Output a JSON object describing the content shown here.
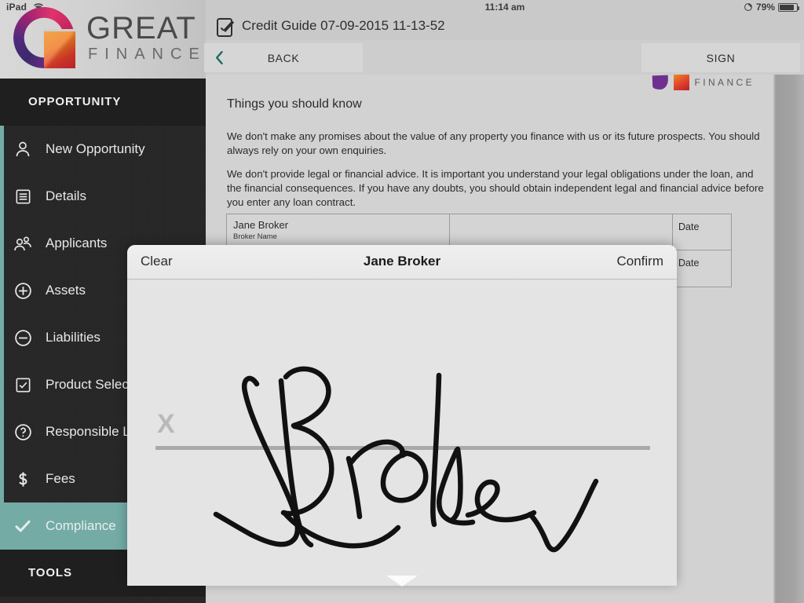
{
  "status_bar": {
    "device_label": "iPad",
    "wifi_icon": "wifi-icon",
    "clock": "11:14 am",
    "rotation_lock_icon": "rotation-lock-icon",
    "battery_percent": "79%",
    "battery_level": 79
  },
  "brand": {
    "name_primary": "GREAT",
    "name_secondary": "FINANCE",
    "logo_icon": "great-finance-logo",
    "colors": {
      "magenta": "#e0336e",
      "purple": "#512a7d",
      "orange": "#f0911f",
      "red": "#c9272c"
    }
  },
  "sidebar": {
    "sections": [
      {
        "header": "OPPORTUNITY",
        "items": [
          {
            "label": "New Opportunity",
            "icon": "person-icon",
            "active": false
          },
          {
            "label": "Details",
            "icon": "document-lines-icon",
            "active": false
          },
          {
            "label": "Applicants",
            "icon": "people-group-icon",
            "active": false
          },
          {
            "label": "Assets",
            "icon": "plus-circle-icon",
            "active": false
          },
          {
            "label": "Liabilities",
            "icon": "minus-circle-icon",
            "active": false
          },
          {
            "label": "Product Selection",
            "icon": "checkbox-icon",
            "active": false
          },
          {
            "label": "Responsible Lending",
            "icon": "question-circle-icon",
            "active": false
          },
          {
            "label": "Fees",
            "icon": "dollar-icon",
            "active": false
          },
          {
            "label": "Compliance",
            "icon": "checkmark-icon",
            "active": true
          }
        ]
      },
      {
        "header": "TOOLS",
        "items": []
      }
    ],
    "accent_color": "#74aba5",
    "background_color": "#262626"
  },
  "titlebar": {
    "icon": "signed-document-icon",
    "title": "Credit Guide 07-09-2015 11-13-52"
  },
  "toolbar": {
    "back_label": "BACK",
    "back_icon": "chevron-left-icon",
    "sign_label": "SIGN"
  },
  "document": {
    "logo_text": "FINANCE",
    "heading": "Things you should know",
    "paragraphs": [
      "We don't make any promises about the value of any property you finance with us or its future prospects.  You should always rely on your own enquiries.",
      "We don't provide legal or financial advice.  It is important you understand your legal obligations under the loan, and the financial consequences.  If you have any doubts, you should obtain independent legal and financial advice before you enter any loan contract."
    ],
    "signature_table": {
      "rows": [
        {
          "name": "Jane Broker",
          "name_sublabel": "Broker Name",
          "signature": "",
          "date_label": "Date"
        },
        {
          "name": "",
          "name_sublabel": "",
          "signature": "",
          "date_label": "Date"
        }
      ]
    }
  },
  "signature_modal": {
    "clear_label": "Clear",
    "title": "Jane Broker",
    "confirm_label": "Confirm",
    "x_marker": "X",
    "signature_value": "J Broker",
    "background_color": "#e4e4e4"
  }
}
